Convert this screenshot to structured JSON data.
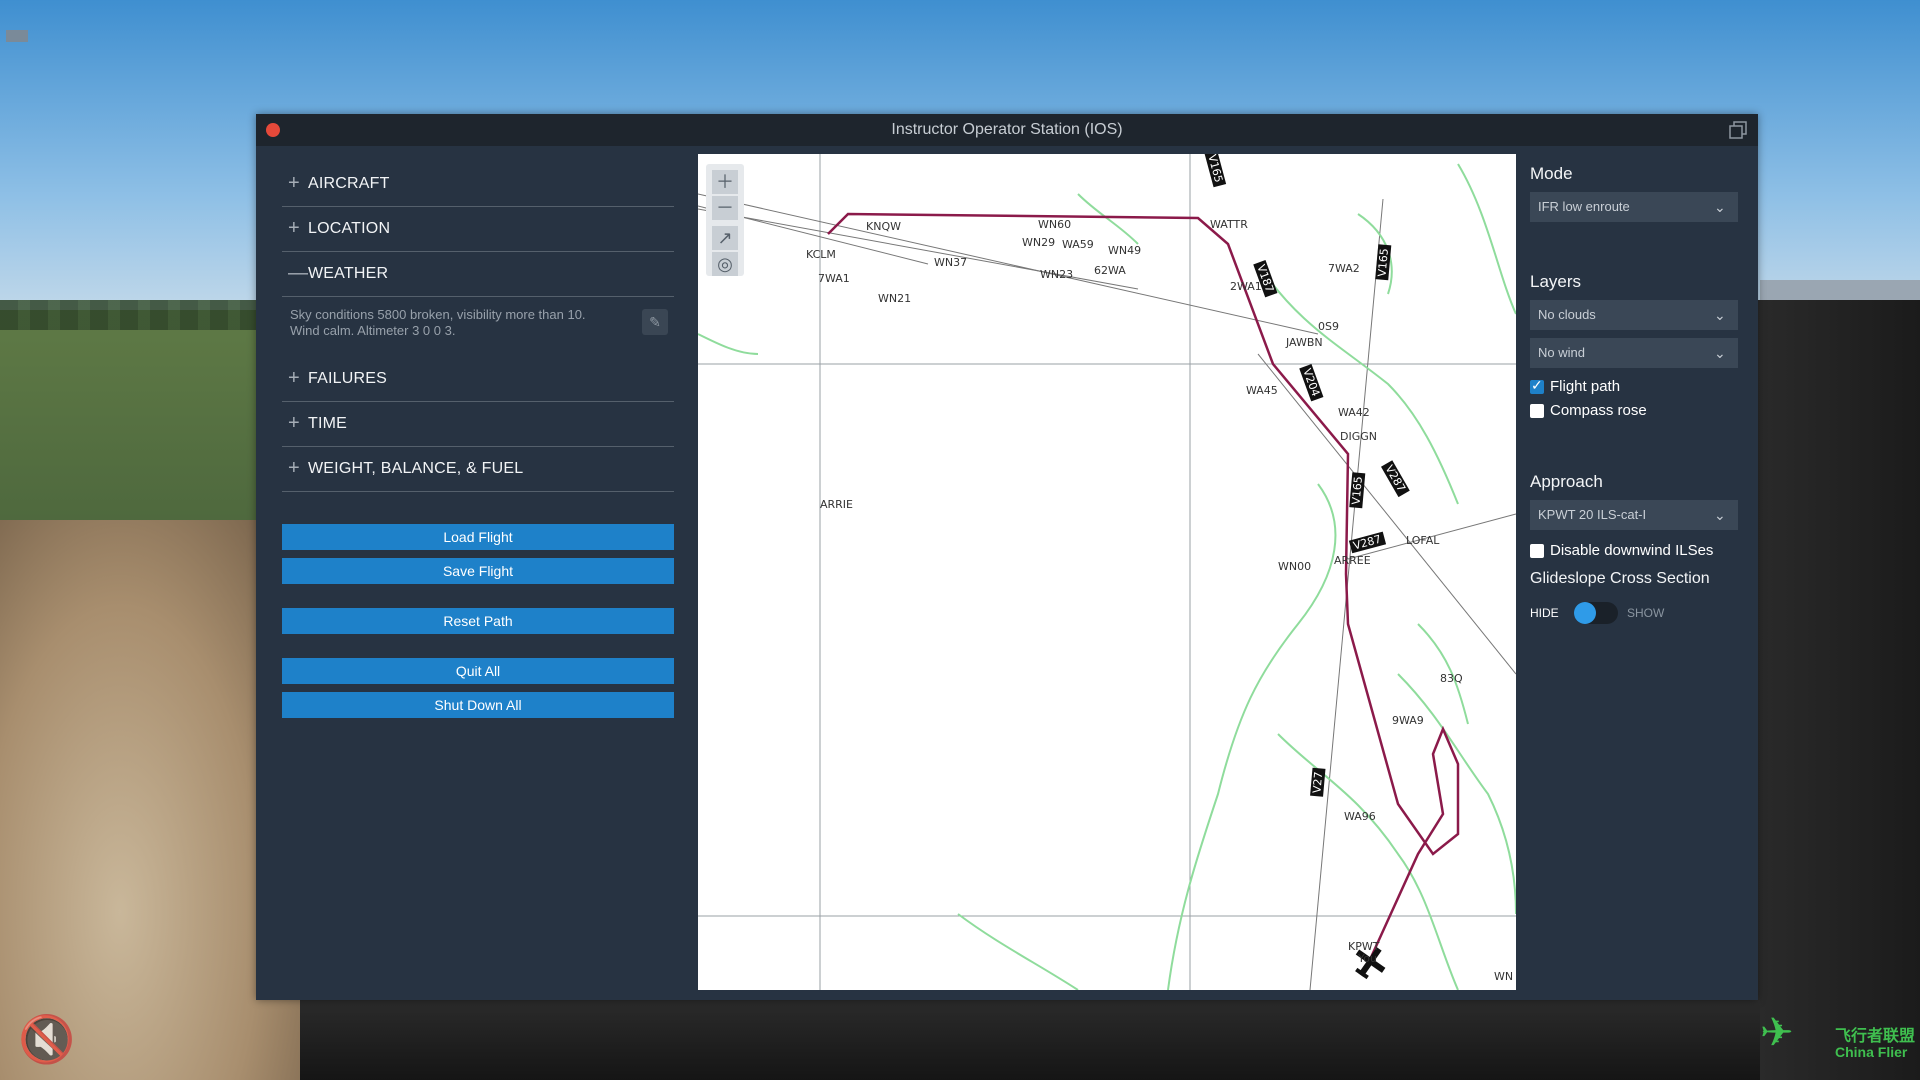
{
  "window": {
    "title": "Instructor Operator Station (IOS)"
  },
  "left_panel": {
    "sections": [
      {
        "sign": "+",
        "label": "AIRCRAFT"
      },
      {
        "sign": "+",
        "label": "LOCATION"
      },
      {
        "sign": "—",
        "label": "WEATHER"
      },
      {
        "sign": "+",
        "label": "FAILURES"
      },
      {
        "sign": "+",
        "label": "TIME"
      },
      {
        "sign": "+",
        "label": "WEIGHT, BALANCE, & FUEL"
      }
    ],
    "weather_summary_line1": "Sky conditions 5800 broken, visibility more than 10.",
    "weather_summary_line2": "Wind calm. Altimeter  3 0 0 3.",
    "buttons": {
      "load_flight": "Load Flight",
      "save_flight": "Save Flight",
      "reset_path": "Reset Path",
      "quit_all": "Quit All",
      "shut_down_all": "Shut Down All"
    }
  },
  "map": {
    "labels": {
      "kclm": "KCLM",
      "twa1": "7WA1",
      "knqw": "KNQW",
      "wn21": "WN21",
      "wn37": "WN37",
      "wn29": "WN29",
      "wn60": "WN60",
      "wa59": "WA59",
      "wn49": "WN49",
      "wa62": "62WA",
      "wn23": "WN23",
      "watter": "WATTR",
      "twa2": "7WA2",
      "twa1b": "2WA1",
      "jawbn": "JAWBN",
      "os9": "0S9",
      "wa45": "WA45",
      "wa42": "WA42",
      "diggn": "DIGGN",
      "arrie": "ARRIE",
      "wn00": "WN00",
      "arree": "ARREE",
      "lofal": "LOFAL",
      "s30": "83Q",
      "wa9": "9WA9",
      "wa96": "WA96",
      "kpwt": "KPWT",
      "you": "You",
      "wn": "WN",
      "v165": "V165",
      "v165b": "V165",
      "v165c": "V165",
      "v287": "V287",
      "v287b": "V287",
      "v27": "V27",
      "v187": "V187",
      "v204": "V204"
    }
  },
  "right_panel": {
    "mode_title": "Mode",
    "mode_value": "IFR low enroute",
    "layers_title": "Layers",
    "layer_clouds": "No clouds",
    "layer_wind": "No wind",
    "flight_path_label": "Flight path",
    "flight_path_checked": true,
    "compass_rose_label": "Compass rose",
    "compass_rose_checked": false,
    "approach_title": "Approach",
    "approach_value": "KPWT 20 ILS-cat-I",
    "disable_downwind_label": "Disable downwind ILSes",
    "glideslope_title": "Glideslope Cross Section",
    "toggle_hide": "HIDE",
    "toggle_show": "SHOW",
    "glideslope_shown": false
  },
  "watermark": {
    "cn": "飞行者联盟",
    "en": "China Flier"
  },
  "colors": {
    "accent": "#1e81c9",
    "flight_path": "#8b1a4a",
    "terrain": "#7bd38a"
  }
}
